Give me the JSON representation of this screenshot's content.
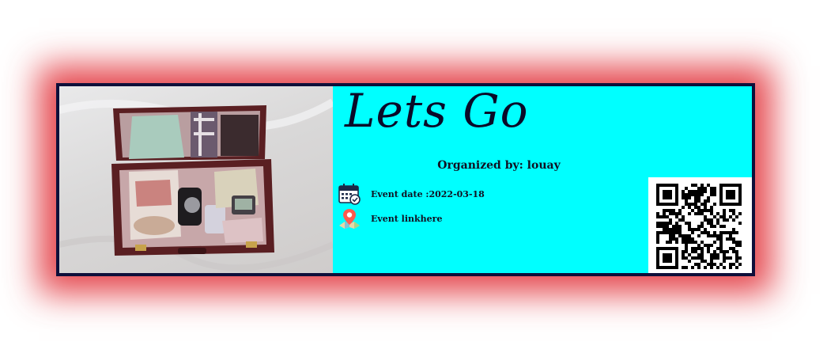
{
  "event": {
    "title": "Lets Go",
    "organizer_text": "Organized by: louay",
    "date_text": "Event date :2022-03-18",
    "link_text": "Event linkhere"
  },
  "icons": {
    "date_icon": "calendar-check-icon",
    "link_icon": "map-location-pin-icon"
  },
  "colors": {
    "card_background": "#00ffff",
    "card_border": "#0e0f3a",
    "glow": "#e02830",
    "pin": "#ff5a4e"
  }
}
